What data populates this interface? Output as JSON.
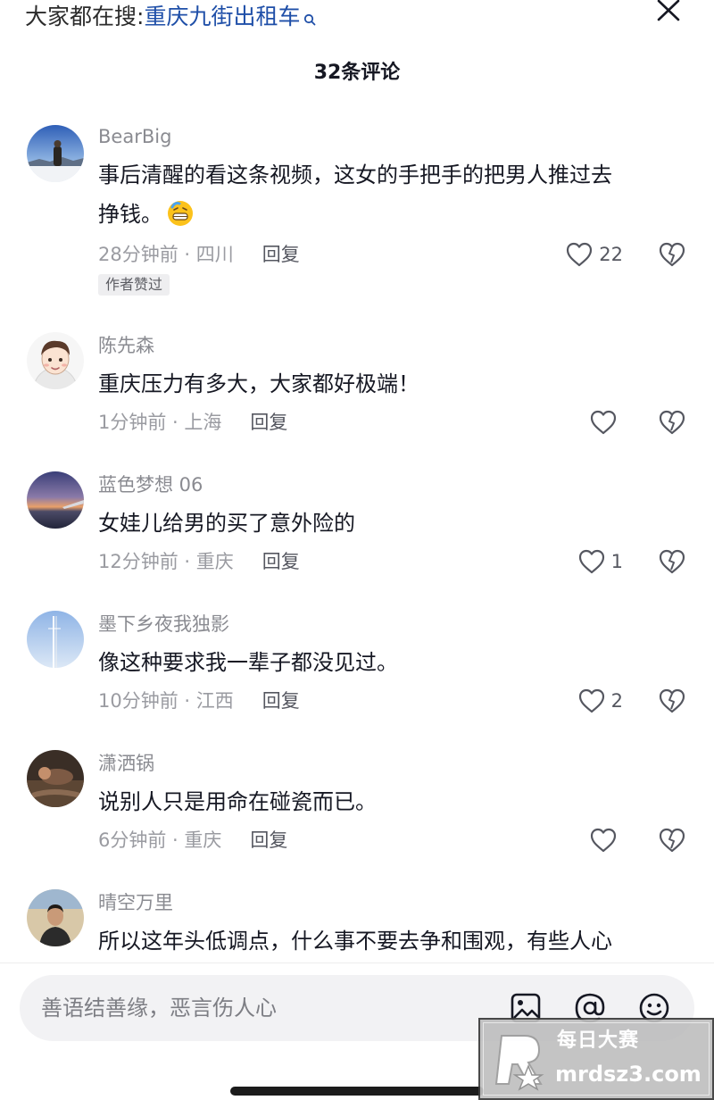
{
  "header": {
    "search_prefix": "大家都在搜:",
    "search_term": "重庆九街出租车",
    "comment_count_title": "32条评论"
  },
  "comments": [
    {
      "username": "BearBig",
      "line1": "事后清醒的看这条视频，这女的手把手的把男人推过去",
      "line2": "挣钱。",
      "emoji_icon": "grimacing-sweat-emoji-icon",
      "time_location": "28分钟前 · 四川",
      "reply_label": "回复",
      "like_count": "22",
      "author_badge": "作者赞过"
    },
    {
      "username": "陈先森",
      "text": "重庆压力有多大，大家都好极端！",
      "time_location": "1分钟前 · 上海",
      "reply_label": "回复",
      "like_count": ""
    },
    {
      "username": "蓝色梦想 06",
      "text": "女娃儿给男的买了意外险的",
      "time_location": "12分钟前 · 重庆",
      "reply_label": "回复",
      "like_count": "1"
    },
    {
      "username": "墨下乡夜我独影",
      "text": "像这种要求我一辈子都没见过。",
      "time_location": "10分钟前 · 江西",
      "reply_label": "回复",
      "like_count": "2"
    },
    {
      "username": "潇洒锅",
      "text": "说别人只是用命在碰瓷而已。",
      "time_location": "6分钟前 · 重庆",
      "reply_label": "回复",
      "like_count": ""
    },
    {
      "username": "晴空万里",
      "text": "所以这年头低调点，什么事不要去争和围观，有些人心"
    }
  ],
  "input": {
    "placeholder": "善语结善缘，恶言伤人心"
  },
  "watermark": {
    "title": "每日大赛",
    "url": "mrdsz3.com"
  },
  "colors": {
    "search_term": "#1f4fa8",
    "text_primary": "#161823",
    "text_secondary": "#8a8b91",
    "input_bg": "#f2f2f4"
  }
}
